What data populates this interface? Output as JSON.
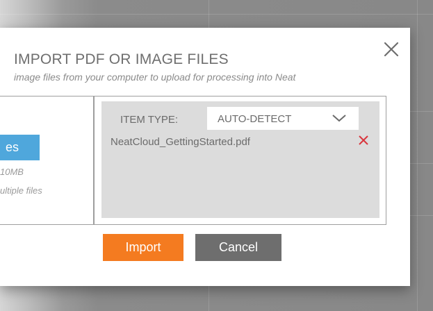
{
  "dialog": {
    "title": "IMPORT PDF OR IMAGE FILES",
    "subtitle": "image files from your computer to upload for processing into Neat",
    "close_icon": "close-icon"
  },
  "left_pane": {
    "select_button_label": "es",
    "size_note": "10MB",
    "multi_note": "ultiple files"
  },
  "item_type": {
    "label": "ITEM TYPE:",
    "selected": "AUTO-DETECT",
    "chevron_icon": "chevron-down-icon"
  },
  "files": [
    {
      "name": "NeatCloud_GettingStarted.pdf",
      "remove_icon": "remove-icon"
    }
  ],
  "actions": {
    "import_label": "Import",
    "cancel_label": "Cancel"
  },
  "colors": {
    "accent_orange": "#f47b20",
    "accent_blue": "#4fa7dc",
    "cancel_gray": "#6e6e6e",
    "remove_red": "#d9363e",
    "file_panel_bg": "#dcdcdc"
  }
}
